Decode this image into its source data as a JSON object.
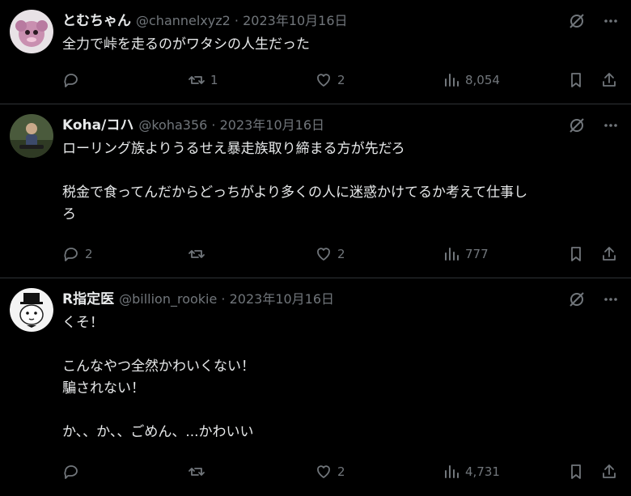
{
  "posts": [
    {
      "name": "とむちゃん",
      "handle": "@channelxyz2",
      "date": "2023年10月16日",
      "lines": [
        "全力で峠を走るのがワタシの人生だった"
      ],
      "replies": "",
      "reposts": "1",
      "likes": "2",
      "views": "8,054"
    },
    {
      "name": "Koha/コハ",
      "handle": "@koha356",
      "date": "2023年10月16日",
      "lines": [
        "ローリング族よりうるせえ暴走族取り締まる方が先だろ",
        "",
        "税金で食ってんだからどっちがより多くの人に迷惑かけてるか考えて仕事し",
        "ろ"
      ],
      "replies": "2",
      "reposts": "",
      "likes": "2",
      "views": "777"
    },
    {
      "name": "R指定医",
      "handle": "@billion_rookie",
      "date": "2023年10月16日",
      "lines": [
        "くそ！",
        "",
        "こんなやつ全然かわいくない！",
        "騙されない！",
        "",
        "か、、か、、ごめん、...かわいい"
      ],
      "replies": "",
      "reposts": "",
      "likes": "2",
      "views": "4,731"
    }
  ],
  "colors": {
    "background": "#000000",
    "text": "#e7e9ea",
    "muted": "#71767b",
    "divider": "#2f3336"
  },
  "icons": [
    "grok-icon",
    "more-icon",
    "reply-icon",
    "repost-icon",
    "like-icon",
    "views-icon",
    "bookmark-icon",
    "share-icon"
  ]
}
